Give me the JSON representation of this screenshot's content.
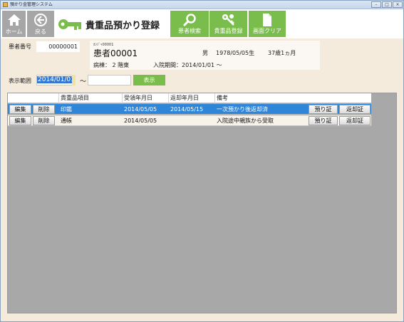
{
  "window": {
    "title": "預かり金管理システム"
  },
  "toolbar": {
    "home_label": "ホーム",
    "back_label": "戻る",
    "screen_title": "貴重品預かり登録",
    "patient_search_label": "患者検索",
    "valuables_register_label": "貴重品登録",
    "screen_clear_label": "画面クリア"
  },
  "patient": {
    "id_label": "患者番号",
    "id_value": "00000001",
    "kana": "ｶﾝｼﾞｬ00001",
    "name": "患者00001",
    "gender": "男",
    "dob": "1978/05/05生",
    "age": "37歳1ヵ月",
    "ward": "病棟： 2 階東",
    "admission": "入院期間：2014/01/01 ～"
  },
  "range": {
    "label": "表示範囲",
    "from": "2014/01/01",
    "tilde": "～",
    "to": "",
    "show_label": "表示"
  },
  "grid": {
    "headers": [
      "貴重品項目",
      "受領年月日",
      "返却年月日",
      "備考"
    ],
    "rows": [
      {
        "edit": "編集",
        "delete": "削除",
        "item": "印鑑",
        "received": "2014/05/05",
        "returned": "2014/05/15",
        "note": "一次預かり後返却済",
        "receipt": "預り証",
        "return_receipt": "返却証"
      },
      {
        "edit": "編集",
        "delete": "削除",
        "item": "通帳",
        "received": "2014/05/05",
        "returned": "",
        "note": "入院途中親族から受取",
        "receipt": "預り証",
        "return_receipt": "返却証"
      }
    ]
  },
  "colors": {
    "accent_green": "#7bbd4c",
    "selected_row": "#2f86d8",
    "toolbar_gray": "#a6a6a6"
  },
  "icons": [
    "home-icon",
    "back-arrow-icon",
    "key-icon",
    "search-icon",
    "keys-icon",
    "document-icon"
  ]
}
